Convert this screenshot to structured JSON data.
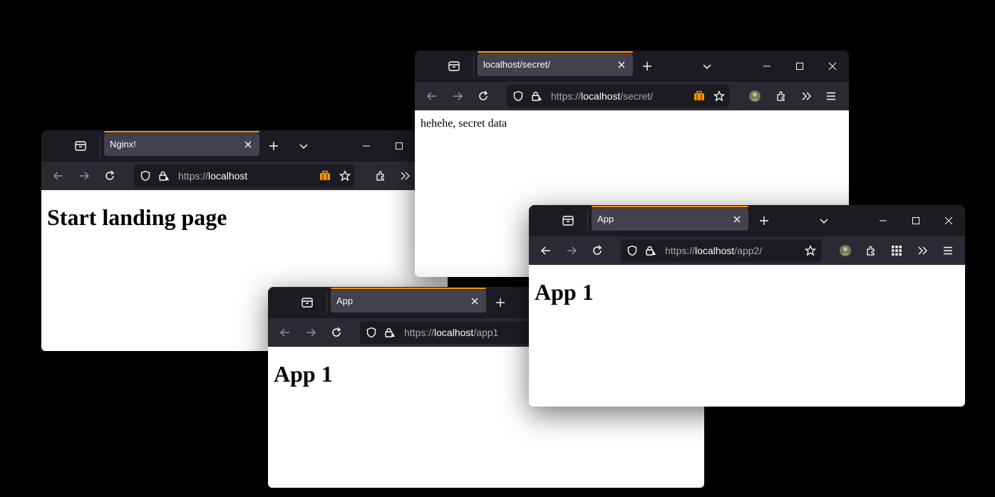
{
  "windows": {
    "nginx": {
      "tab_title": "Nginx!",
      "url_scheme": "https://",
      "url_host": "localhost",
      "url_path": "",
      "heading": "Start landing page"
    },
    "secret": {
      "tab_title": "localhost/secret/",
      "url_scheme": "https://",
      "url_host": "localhost",
      "url_path": "/secret/",
      "paragraph": "hehehe, secret data"
    },
    "app1": {
      "tab_title": "App",
      "url_scheme": "https://",
      "url_host": "localhost",
      "url_path": "/app1",
      "heading": "App 1"
    },
    "app2": {
      "tab_title": "App",
      "url_scheme": "https://",
      "url_host": "localhost",
      "url_path": "/app2/",
      "heading": "App 1"
    }
  },
  "icons": [
    "tab-groups-icon",
    "close-icon",
    "plus-icon",
    "chevron-down-icon",
    "minimize-icon",
    "maximize-icon",
    "back-arrow-icon",
    "forward-arrow-icon",
    "reload-icon",
    "tracking-shield-icon",
    "insecure-lock-icon",
    "briefcase-icon",
    "star-icon",
    "extensions-icon",
    "overflow-icon",
    "menu-icon",
    "grid-icon",
    "avatar-icon"
  ],
  "colors": {
    "tab_accent": "#ff9400",
    "toolbar": "#2b2a33",
    "titlebar": "#1c1b22",
    "briefcase": "#ff9400"
  }
}
